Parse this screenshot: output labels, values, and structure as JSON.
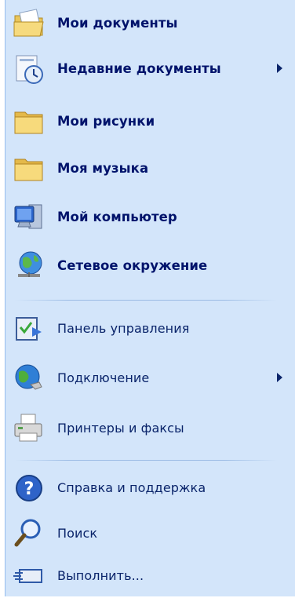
{
  "menu": {
    "items": [
      {
        "label": "Мои документы",
        "icon": "my-documents-icon"
      },
      {
        "label": "Недавние документы",
        "icon": "recent-documents-icon",
        "submenu": true
      },
      {
        "label": "Мои рисунки",
        "icon": "folder-icon"
      },
      {
        "label": "Моя музыка",
        "icon": "folder-icon"
      },
      {
        "label": "Мой компьютер",
        "icon": "my-computer-icon"
      },
      {
        "label": "Сетевое окружение",
        "icon": "network-places-icon"
      },
      {
        "label": "Панель управления",
        "icon": "control-panel-icon"
      },
      {
        "label": "Подключение",
        "icon": "connect-to-icon",
        "submenu": true
      },
      {
        "label": "Принтеры и факсы",
        "icon": "printers-faxes-icon"
      },
      {
        "label": "Справка и поддержка",
        "icon": "help-icon"
      },
      {
        "label": "Поиск",
        "icon": "search-icon"
      },
      {
        "label": "Выполнить...",
        "icon": "run-icon"
      }
    ]
  },
  "colors": {
    "panel_bg": "#d3e5fa",
    "text": "#00136b",
    "separator": "#9bbbe4"
  }
}
